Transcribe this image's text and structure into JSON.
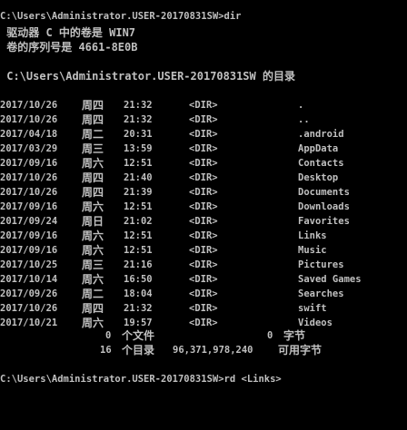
{
  "console": {
    "prompt_dir_cmd": "C:\\Users\\Administrator.USER-20170831SW>dir",
    "volume_line": " 驱动器 C 中的卷是 WIN7",
    "serial_line": " 卷的序列号是 4661-8E0B",
    "directory_line": " C:\\Users\\Administrator.USER-20170831SW 的目录",
    "entries": [
      {
        "date": "2017/10/26",
        "day": "周四",
        "time": "21:32",
        "type": "<DIR>",
        "name": "."
      },
      {
        "date": "2017/10/26",
        "day": "周四",
        "time": "21:32",
        "type": "<DIR>",
        "name": ".."
      },
      {
        "date": "2017/04/18",
        "day": "周二",
        "time": "20:31",
        "type": "<DIR>",
        "name": ".android"
      },
      {
        "date": "2017/03/29",
        "day": "周三",
        "time": "13:59",
        "type": "<DIR>",
        "name": "AppData"
      },
      {
        "date": "2017/09/16",
        "day": "周六",
        "time": "12:51",
        "type": "<DIR>",
        "name": "Contacts"
      },
      {
        "date": "2017/10/26",
        "day": "周四",
        "time": "21:40",
        "type": "<DIR>",
        "name": "Desktop"
      },
      {
        "date": "2017/10/26",
        "day": "周四",
        "time": "21:39",
        "type": "<DIR>",
        "name": "Documents"
      },
      {
        "date": "2017/09/16",
        "day": "周六",
        "time": "12:51",
        "type": "<DIR>",
        "name": "Downloads"
      },
      {
        "date": "2017/09/24",
        "day": "周日",
        "time": "21:02",
        "type": "<DIR>",
        "name": "Favorites"
      },
      {
        "date": "2017/09/16",
        "day": "周六",
        "time": "12:51",
        "type": "<DIR>",
        "name": "Links"
      },
      {
        "date": "2017/09/16",
        "day": "周六",
        "time": "12:51",
        "type": "<DIR>",
        "name": "Music"
      },
      {
        "date": "2017/10/25",
        "day": "周三",
        "time": "21:16",
        "type": "<DIR>",
        "name": "Pictures"
      },
      {
        "date": "2017/10/14",
        "day": "周六",
        "time": "16:50",
        "type": "<DIR>",
        "name": "Saved Games"
      },
      {
        "date": "2017/09/26",
        "day": "周二",
        "time": "18:04",
        "type": "<DIR>",
        "name": "Searches"
      },
      {
        "date": "2017/10/26",
        "day": "周四",
        "time": "21:32",
        "type": "<DIR>",
        "name": "swift"
      },
      {
        "date": "2017/10/21",
        "day": "周六",
        "time": "19:57",
        "type": "<DIR>",
        "name": "Videos"
      }
    ],
    "summary_files_count": "0",
    "summary_files_label": "个文件",
    "summary_files_bytes": "0",
    "summary_bytes_label": "字节",
    "summary_dirs_count": "16",
    "summary_dirs_label": "个目录",
    "summary_free_bytes": "96,371,978,240",
    "summary_free_label": "可用字节",
    "prompt_rd_cmd": "C:\\Users\\Administrator.USER-20170831SW>rd <Links>"
  },
  "colors": {
    "background": "#000000",
    "text": "#c0c0c0"
  }
}
